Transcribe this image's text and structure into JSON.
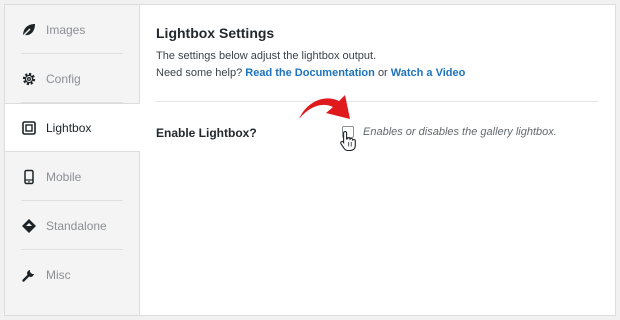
{
  "sidebar": {
    "items": [
      {
        "label": "Images",
        "icon": "leaf-icon"
      },
      {
        "label": "Config",
        "icon": "gear-icon"
      },
      {
        "label": "Lightbox",
        "icon": "lightbox-icon",
        "active": true
      },
      {
        "label": "Mobile",
        "icon": "mobile-icon"
      },
      {
        "label": "Standalone",
        "icon": "standalone-icon"
      },
      {
        "label": "Misc",
        "icon": "wrench-icon"
      }
    ]
  },
  "main": {
    "title": "Lightbox Settings",
    "description": "The settings below adjust the lightbox output.",
    "help_prefix": "Need some help?",
    "doc_link": "Read the Documentation",
    "or_text": "or",
    "video_link": "Watch a Video",
    "setting": {
      "label": "Enable Lightbox?",
      "checked": false,
      "help": "Enables or disables the gallery lightbox."
    }
  },
  "colors": {
    "link": "#1e73be",
    "arrow": "#e0191c"
  }
}
